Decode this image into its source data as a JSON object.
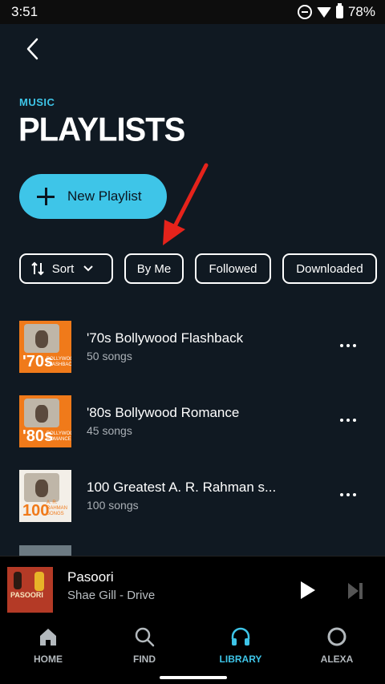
{
  "status": {
    "time": "3:51",
    "battery": "78%"
  },
  "header": {
    "kicker": "MUSIC",
    "title": "PLAYLISTS"
  },
  "actions": {
    "new_playlist": "New Playlist"
  },
  "filters": {
    "sort": "Sort",
    "by_me": "By Me",
    "followed": "Followed",
    "downloaded": "Downloaded"
  },
  "playlists": [
    {
      "name": "'70s Bollywood Flashback",
      "count": "50 songs",
      "art_big": "'70s",
      "art_small": "BOLLYWOOD FLASHBACK"
    },
    {
      "name": "'80s Bollywood Romance",
      "count": "45 songs",
      "art_big": "'80s",
      "art_small": "BOLLYWOOD ROMANCE"
    },
    {
      "name": "100 Greatest A. R. Rahman s...",
      "count": "100 songs",
      "art_big": "100",
      "art_small": "A. R. RAHMAN SONGS"
    }
  ],
  "player": {
    "song": "Pasoori",
    "artist": "Shae Gill - Drive",
    "art_text": "PASOORI"
  },
  "nav": [
    {
      "label": "HOME",
      "icon": "home-icon",
      "active": false
    },
    {
      "label": "FIND",
      "icon": "search-icon",
      "active": false
    },
    {
      "label": "LIBRARY",
      "icon": "headphones-icon",
      "active": true
    },
    {
      "label": "ALEXA",
      "icon": "alexa-icon",
      "active": false
    }
  ],
  "colors": {
    "accent": "#3ec5e8",
    "background": "#101922",
    "annotation_arrow": "#e5231b"
  }
}
